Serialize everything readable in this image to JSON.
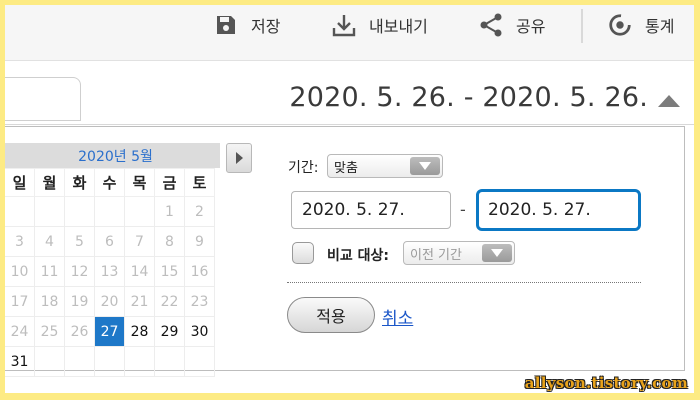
{
  "toolbar": {
    "save_label": "저장",
    "download_label": "내보내기",
    "share_label": "공유",
    "stats_label": "통계"
  },
  "date_range": "2020. 5. 26. - 2020. 5. 26.",
  "calendar": {
    "month_label": "2020년 5월",
    "weekdays": [
      "일",
      "월",
      "화",
      "수",
      "목",
      "금",
      "토"
    ],
    "weeks": [
      [
        "",
        "",
        "",
        "",
        "",
        "1",
        "2"
      ],
      [
        "3",
        "4",
        "5",
        "6",
        "7",
        "8",
        "9"
      ],
      [
        "10",
        "11",
        "12",
        "13",
        "14",
        "15",
        "16"
      ],
      [
        "17",
        "18",
        "19",
        "20",
        "21",
        "22",
        "23"
      ],
      [
        "24",
        "25",
        "26",
        "27",
        "28",
        "29",
        "30"
      ],
      [
        "31",
        "",
        "",
        "",
        "",
        "",
        ""
      ]
    ],
    "selected_day": "27"
  },
  "options": {
    "period_label": "기간:",
    "period_value": "맞춤",
    "start_date": "2020. 5. 27.",
    "range_dash": "-",
    "end_date": "2020. 5. 27.",
    "compare_label": "비교 대상:",
    "compare_value": "이전 기간",
    "compare_checked": false
  },
  "actions": {
    "apply_label": "적용",
    "cancel_label": "취소"
  },
  "watermark": "allyson.tistory.com",
  "colors": {
    "frame": "#fdeb84",
    "accent": "#1e78c8",
    "focus_border": "#0b78c4",
    "link": "#1a56c8"
  }
}
